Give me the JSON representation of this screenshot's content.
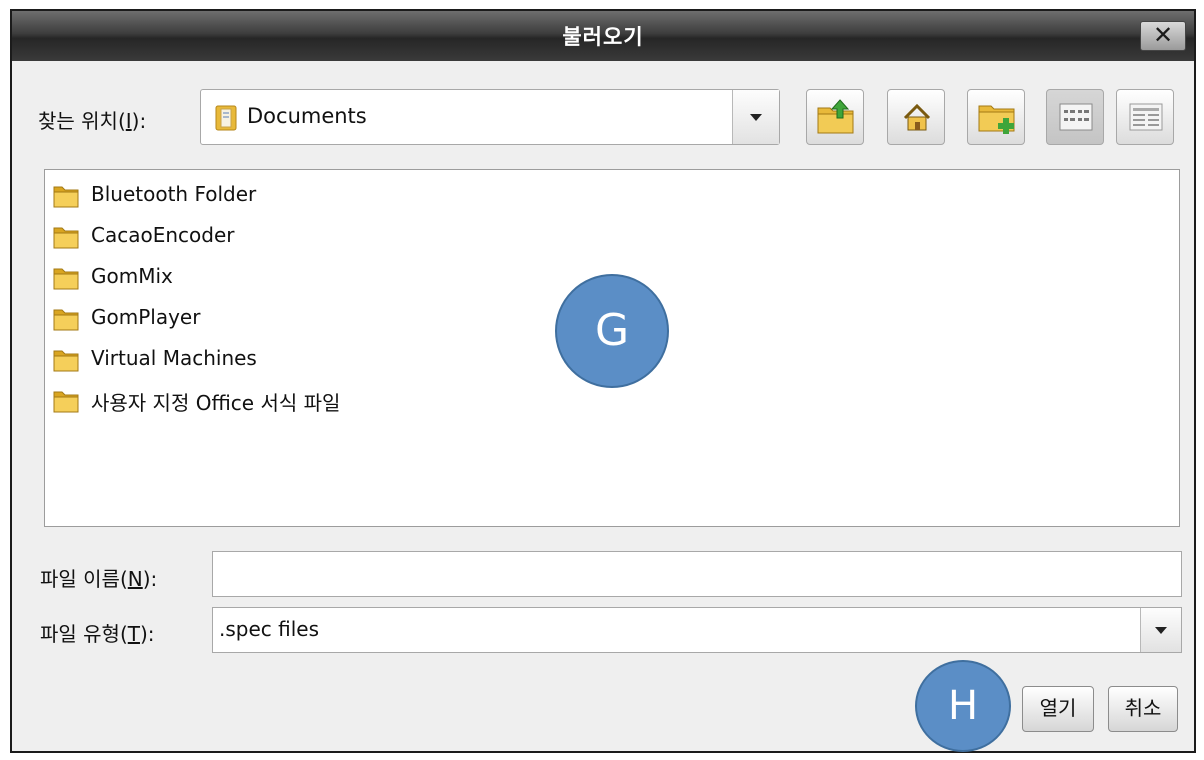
{
  "window": {
    "title": "불러오기",
    "close_symbol": "✕"
  },
  "location": {
    "label_prefix": "찾는 위치(",
    "label_accel": "I",
    "label_suffix": "):",
    "value": "Documents"
  },
  "toolbar": {
    "buttons": [
      "up-one-level",
      "home",
      "create-new-folder",
      "list-view",
      "details-view"
    ]
  },
  "files": [
    {
      "name": "Bluetooth Folder"
    },
    {
      "name": "CacaoEncoder"
    },
    {
      "name": "GomMix"
    },
    {
      "name": "GomPlayer"
    },
    {
      "name": "Virtual Machines"
    },
    {
      "name": "사용자 지정 Office 서식 파일"
    }
  ],
  "file_name": {
    "label_prefix": "파일 이름(",
    "label_accel": "N",
    "label_suffix": "):",
    "value": ""
  },
  "file_type": {
    "label_prefix": "파일 유형(",
    "label_accel": "T",
    "label_suffix": "):",
    "value": ".spec files"
  },
  "actions": {
    "open": "열기",
    "cancel": "취소"
  },
  "annotations": {
    "list_marker": "G",
    "open_marker": "H"
  },
  "colors": {
    "marker": "#5b8ec6",
    "titlebar": "#2c2c2c",
    "folder": "#e8b93a"
  }
}
